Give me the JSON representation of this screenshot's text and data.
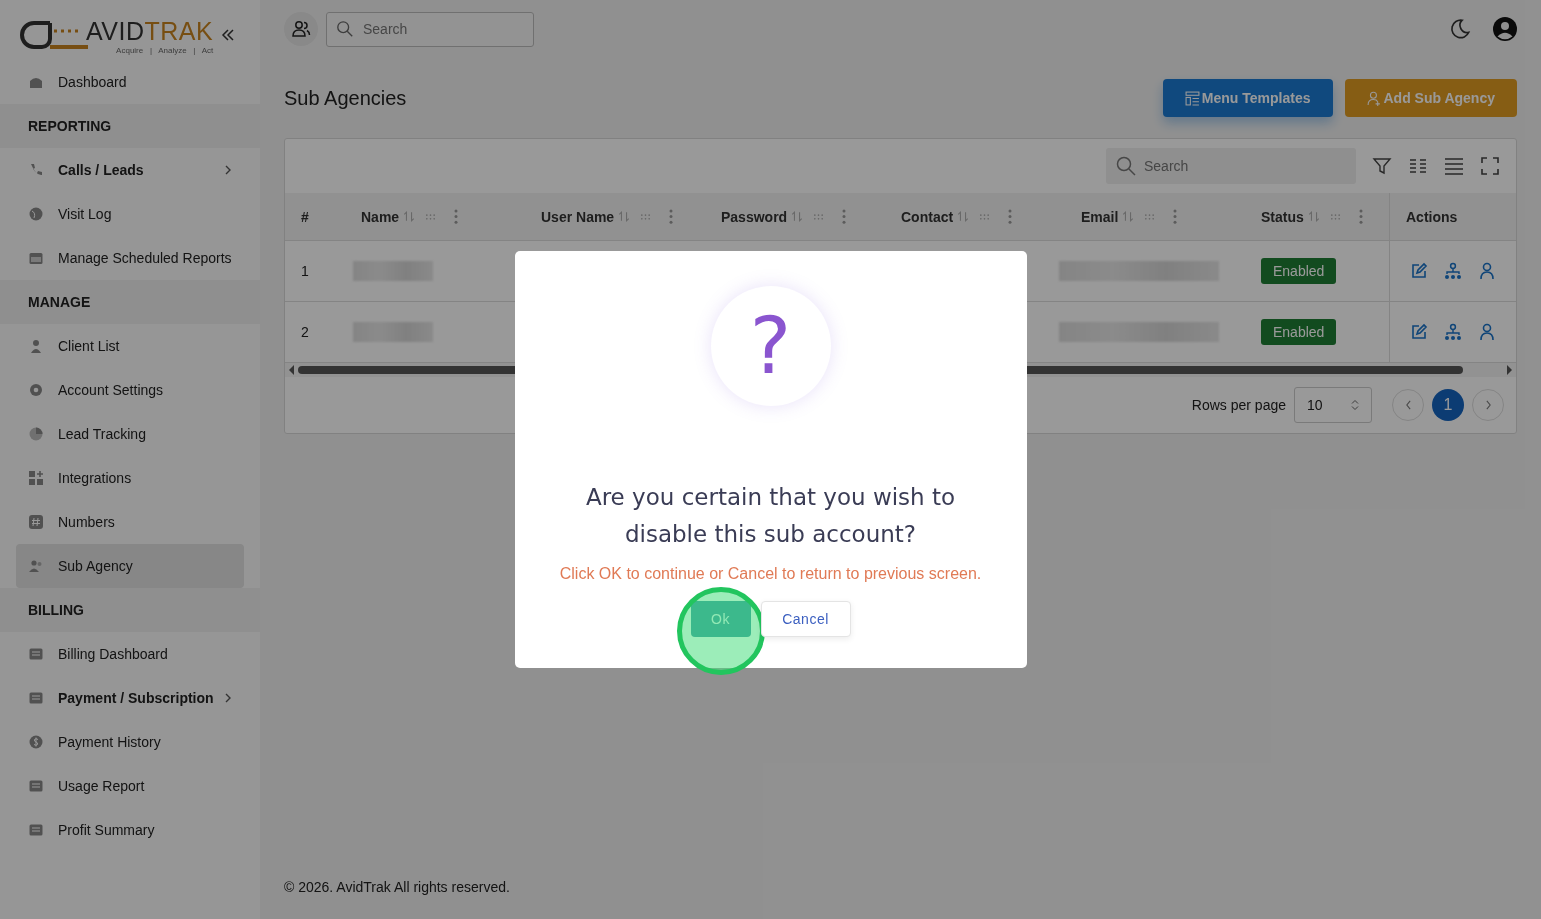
{
  "logo": {
    "dark": "AVID",
    "accent": "TRAK",
    "tagline": [
      "Acquire",
      "|",
      "Analyze",
      "|",
      "Act"
    ]
  },
  "sidebar": {
    "items": [
      {
        "kind": "item",
        "label": "Dashboard",
        "selected": false,
        "expandable": false
      },
      {
        "kind": "section",
        "label": "REPORTING"
      },
      {
        "kind": "item",
        "label": "Calls / Leads",
        "selected": false,
        "expandable": true
      },
      {
        "kind": "item",
        "label": "Visit Log",
        "selected": false,
        "expandable": false
      },
      {
        "kind": "item",
        "label": "Manage Scheduled Reports",
        "selected": false,
        "expandable": false
      },
      {
        "kind": "section",
        "label": "MANAGE"
      },
      {
        "kind": "item",
        "label": "Client List",
        "selected": false,
        "expandable": false
      },
      {
        "kind": "item",
        "label": "Account Settings",
        "selected": false,
        "expandable": false
      },
      {
        "kind": "item",
        "label": "Lead Tracking",
        "selected": false,
        "expandable": false
      },
      {
        "kind": "item",
        "label": "Integrations",
        "selected": false,
        "expandable": false
      },
      {
        "kind": "item",
        "label": "Numbers",
        "selected": false,
        "expandable": false
      },
      {
        "kind": "item",
        "label": "Sub Agency",
        "selected": true,
        "expandable": false
      },
      {
        "kind": "section",
        "label": "BILLING"
      },
      {
        "kind": "item",
        "label": "Billing Dashboard",
        "selected": false,
        "expandable": false
      },
      {
        "kind": "item",
        "label": "Payment / Subscription",
        "selected": false,
        "expandable": true
      },
      {
        "kind": "item",
        "label": "Payment History",
        "selected": false,
        "expandable": false
      },
      {
        "kind": "item",
        "label": "Usage Report",
        "selected": false,
        "expandable": false
      },
      {
        "kind": "item",
        "label": "Profit Summary",
        "selected": false,
        "expandable": false
      }
    ]
  },
  "topbar": {
    "search": {
      "placeholder": "Search"
    }
  },
  "page": {
    "title": "Sub Agencies",
    "buttons": [
      {
        "label": "Menu Templates",
        "kind": "primary"
      },
      {
        "label": "Add Sub Agency",
        "kind": "warning"
      }
    ]
  },
  "table": {
    "search": {
      "placeholder": "Search"
    },
    "columns": [
      {
        "label": "#"
      },
      {
        "label": "Name",
        "sortable": true
      },
      {
        "label": "User Name",
        "sortable": true
      },
      {
        "label": "Password",
        "sortable": true
      },
      {
        "label": "Contact",
        "sortable": true
      },
      {
        "label": "Email",
        "sortable": true
      },
      {
        "label": "Status",
        "sortable": true
      },
      {
        "label": "Actions",
        "sortable": false
      }
    ],
    "rows": [
      {
        "index": "1",
        "status": "Enabled"
      },
      {
        "index": "2",
        "status": "Enabled"
      }
    ],
    "rows_per_page_label": "Rows per page",
    "rows_per_page": "10",
    "pages": [
      {
        "label": "1",
        "selected": true
      }
    ]
  },
  "footer": "© 2026. AvidTrak All rights reserved.",
  "dialog": {
    "icon": "?",
    "title": "Are you certain that you wish to disable this sub account?",
    "message": "Click OK to continue or Cancel to return to previous screen.",
    "buttons": [
      {
        "label": "Ok",
        "kind": "confirm"
      },
      {
        "label": "Cancel",
        "kind": "cancel"
      }
    ],
    "click_highlight": true
  }
}
